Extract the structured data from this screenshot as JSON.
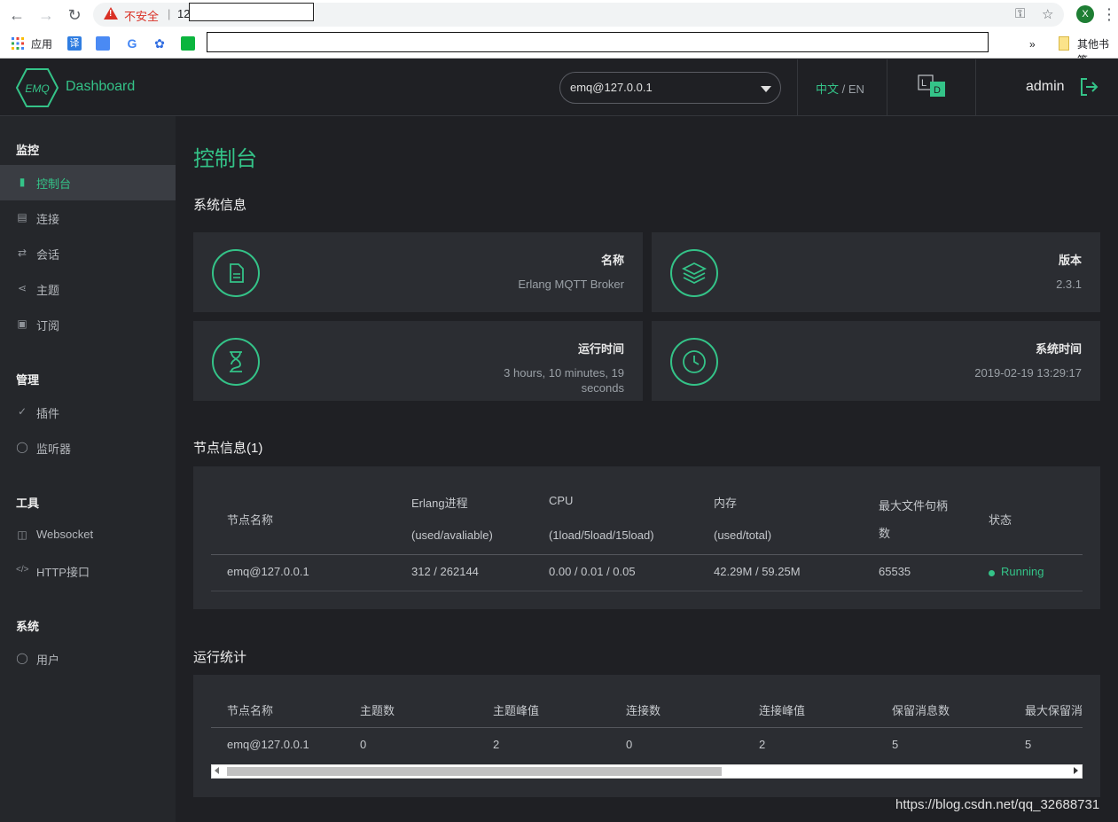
{
  "browser": {
    "insecure_label": "不安全",
    "separator": "|",
    "url_prefix": "12",
    "profile_initial": "X",
    "bookmarks": {
      "apps_label": "应用",
      "more_label": "»",
      "other_bookmarks": "其他书签"
    }
  },
  "header": {
    "logo_text": "EMQ",
    "app_title": "Dashboard",
    "node_selected": "emq@127.0.0.1",
    "lang_cn": "中文",
    "lang_sep": " / ",
    "lang_en": "EN",
    "user": "admin",
    "theme_light": "L",
    "theme_dark": "D"
  },
  "sidebar": {
    "groups": [
      {
        "label": "监控",
        "items": [
          {
            "label": "控制台",
            "icon": "bar-chart-icon",
            "active": true
          },
          {
            "label": "连接",
            "icon": "connection-icon"
          },
          {
            "label": "会话",
            "icon": "swap-icon"
          },
          {
            "label": "主题",
            "icon": "topic-icon"
          },
          {
            "label": "订阅",
            "icon": "rss-icon"
          }
        ]
      },
      {
        "label": "管理",
        "items": [
          {
            "label": "插件",
            "icon": "plug-icon"
          },
          {
            "label": "监听器",
            "icon": "listener-icon"
          }
        ]
      },
      {
        "label": "工具",
        "items": [
          {
            "label": "Websocket",
            "icon": "html5-icon"
          },
          {
            "label": "HTTP接口",
            "icon": "code-icon"
          }
        ]
      },
      {
        "label": "系统",
        "items": [
          {
            "label": "用户",
            "icon": "user-icon"
          }
        ]
      }
    ]
  },
  "main": {
    "title": "控制台",
    "system_info_title": "系统信息",
    "cards": [
      {
        "label": "名称",
        "value": "Erlang MQTT Broker",
        "icon": "document-icon"
      },
      {
        "label": "版本",
        "value": "2.3.1",
        "icon": "layers-icon"
      },
      {
        "label": "运行时间",
        "value_line1": "3 hours, 10 minutes, 19",
        "value_line2": "seconds",
        "icon": "hourglass-icon"
      },
      {
        "label": "系统时间",
        "value": "2019-02-19 13:29:17",
        "icon": "clock-icon"
      }
    ],
    "nodes_title": "节点信息(1)",
    "nodes_table": {
      "headers": [
        {
          "line1": "节点名称"
        },
        {
          "line1": "Erlang进程",
          "line2": "(used/avaliable)"
        },
        {
          "line1": "CPU",
          "line2": "(1load/5load/15load)"
        },
        {
          "line1": "内存",
          "line2": "(used/total)"
        },
        {
          "line1": "最大文件句柄",
          "line2": "数"
        },
        {
          "line1": "状态"
        }
      ],
      "rows": [
        [
          "emq@127.0.0.1",
          "312 / 262144",
          "0.00 / 0.01 / 0.05",
          "42.29M / 59.25M",
          "65535",
          "Running"
        ]
      ]
    },
    "stats_title": "运行统计",
    "stats_table": {
      "headers": [
        "节点名称",
        "主题数",
        "主题峰值",
        "连接数",
        "连接峰值",
        "保留消息数",
        "最大保留消"
      ],
      "rows": [
        [
          "emq@127.0.0.1",
          "0",
          "2",
          "0",
          "2",
          "5",
          "5"
        ]
      ]
    }
  },
  "watermark": "https://blog.csdn.net/qq_32688731",
  "colors": {
    "accent": "#34c388",
    "background": "#1f2024",
    "sidebar": "#25272b",
    "card": "#2b2d32",
    "insecure": "#d93025"
  }
}
